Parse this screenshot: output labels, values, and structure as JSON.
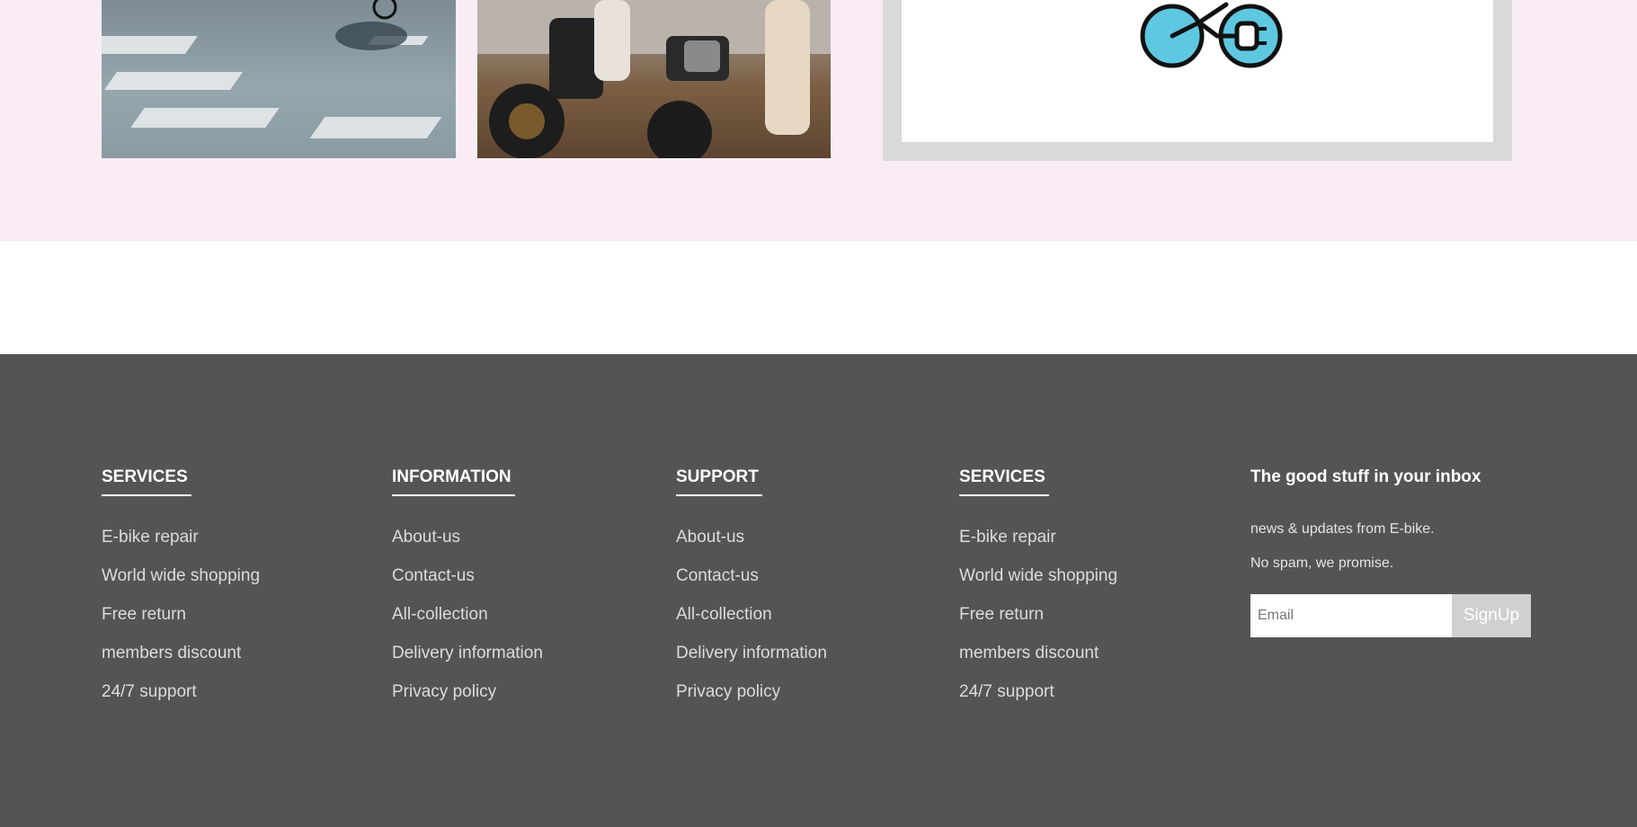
{
  "footer": {
    "columns": [
      {
        "heading": "SERVICES",
        "links": [
          "E-bike repair",
          "World wide shopping",
          "Free return",
          "members discount",
          "24/7 support"
        ]
      },
      {
        "heading": "INFORMATION",
        "links": [
          "About-us",
          "Contact-us",
          "All-collection",
          "Delivery information",
          "Privacy policy"
        ]
      },
      {
        "heading": "SUPPORT",
        "links": [
          "About-us",
          "Contact-us",
          "All-collection",
          "Delivery information",
          "Privacy policy"
        ]
      },
      {
        "heading": "SERVICES",
        "links": [
          "E-bike repair",
          "World wide shopping",
          "Free return",
          "members discount",
          "24/7 support"
        ]
      }
    ],
    "newsletter": {
      "heading": "The good stuff in your inbox",
      "line1": "news & updates from E-bike.",
      "line2": "No spam, we promise.",
      "email_placeholder": "Email",
      "signup_label": "SignUp"
    }
  },
  "icons": {
    "logo": "ebike-plug-icon"
  },
  "colors": {
    "pink_bg": "#f9ecf5",
    "footer_bg": "#545454",
    "logo_wheel": "#5ec8e0",
    "card_border": "#d9d9d9"
  }
}
